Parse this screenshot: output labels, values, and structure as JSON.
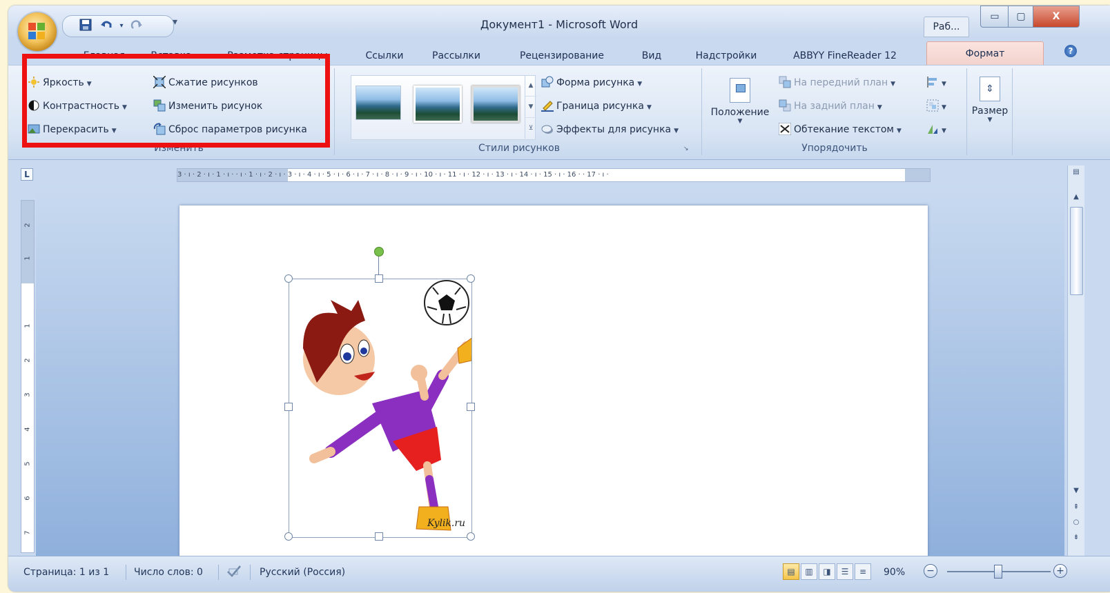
{
  "window": {
    "title": "Документ1 - Microsoft Word",
    "task_button": "Раб...",
    "minimize_label": "▭",
    "maximize_label": "▢",
    "close_label": "X"
  },
  "qat": {
    "save_icon": "save-icon",
    "undo_icon": "undo-icon",
    "redo_icon": "redo-icon",
    "more": "▾"
  },
  "tabs": [
    {
      "label": "Главная"
    },
    {
      "label": "Вставка"
    },
    {
      "label": "Разметка страницы"
    },
    {
      "label": "Ссылки"
    },
    {
      "label": "Рассылки"
    },
    {
      "label": "Рецензирование"
    },
    {
      "label": "Вид"
    },
    {
      "label": "Надстройки"
    },
    {
      "label": "ABBYY FineReader 12"
    },
    {
      "label": "Формат",
      "active": true
    }
  ],
  "help": "?",
  "ribbon": {
    "adjust": {
      "label": "Изменить",
      "brightness": "Яркость",
      "contrast": "Контрастность",
      "recolor": "Перекрасить",
      "compress": "Сжатие рисунков",
      "change": "Изменить рисунок",
      "reset": "Сброс параметров рисунка"
    },
    "styles": {
      "label": "Стили рисунков",
      "shape": "Форма рисунка",
      "border": "Граница рисунка",
      "effects": "Эффекты для рисунка"
    },
    "arrange": {
      "label": "Упорядочить",
      "position": "Положение",
      "bring_front": "На передний план",
      "send_back": "На задний план",
      "wrap": "Обтекание текстом"
    },
    "size": {
      "label": "Размер"
    }
  },
  "ruler": {
    "corner": "L",
    "text": "3 · ı · 2 · ı · 1 · ı ·   · ı · 1 · ı · 2 · ı · 3 · ı · 4 · ı · 5 · ı · 6 · ı · 7 · ı · 8 · ı · 9 · ı · 10 · ı · 11 · ı · 12 · ı · 13 · ı · 14 · ı · 15 · ı · 16 ·   · 17 · ı ·",
    "vertical_marks": [
      "2",
      "1",
      "1",
      "2",
      "3",
      "4",
      "5",
      "6",
      "7"
    ]
  },
  "picture": {
    "watermark": "Kylik.ru"
  },
  "status": {
    "page": "Страница: 1 из 1",
    "words": "Число слов: 0",
    "language": "Русский (Россия)",
    "zoom": "90%",
    "zoom_value": 90
  },
  "colors": {
    "accent_red": "#ee1111",
    "active_tab": "#f2d2cc"
  }
}
